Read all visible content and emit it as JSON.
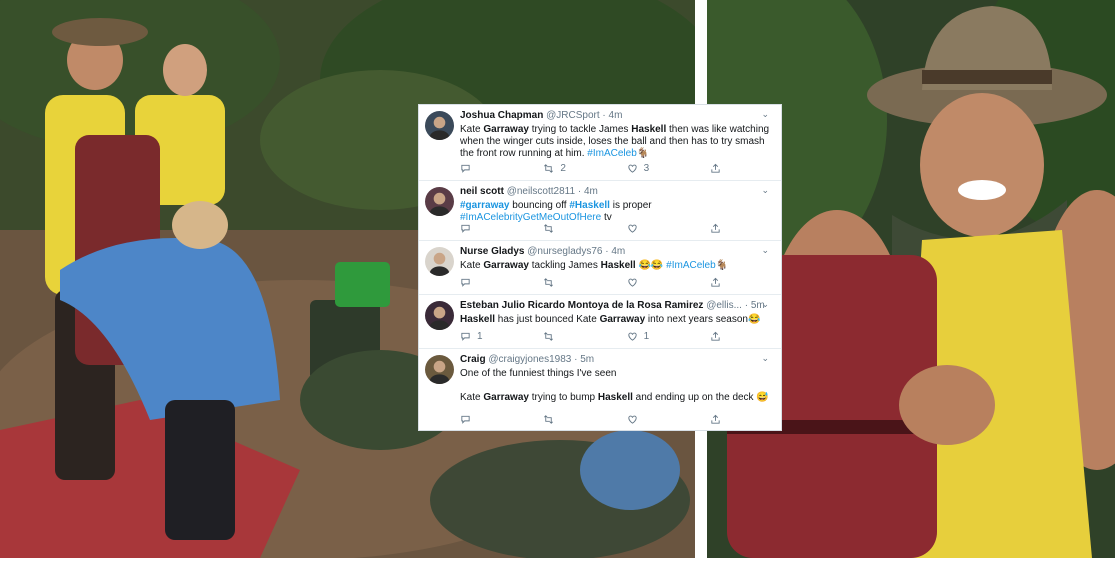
{
  "tweets": [
    {
      "name": "Joshua Chapman",
      "handle": "@JRCSport",
      "dot": "·",
      "time": "4m",
      "chevron": "⌄",
      "body": [
        [
          {
            "t": "Kate "
          },
          {
            "t": "Garraway",
            "b": true
          },
          {
            "t": " trying to tackle James "
          },
          {
            "t": "Haskell",
            "b": true
          },
          {
            "t": " then was like watching when the winger cuts inside, loses the ball and then has to try smash the front row running at him. "
          },
          {
            "t": "#ImACeleb",
            "link": true
          },
          {
            "t": "🐐"
          }
        ]
      ],
      "reply_count": "",
      "retweet_count": "2",
      "like_count": "3",
      "avatar_color": "#3b4a5a"
    },
    {
      "name": "neil scott",
      "handle": "@neilscott2811",
      "dot": "·",
      "time": "4m",
      "chevron": "⌄",
      "body": [
        [
          {
            "t": "#garraway",
            "link": true,
            "b": true
          },
          {
            "t": " bouncing off "
          },
          {
            "t": "#Haskell",
            "link": true,
            "b": true
          },
          {
            "t": " is proper "
          },
          {
            "t": "#ImACelebrityGetMeOutOfHere",
            "link": true
          },
          {
            "t": " tv"
          }
        ]
      ],
      "reply_count": "",
      "retweet_count": "",
      "like_count": "",
      "avatar_color": "#5a3c46"
    },
    {
      "name": "Nurse Gladys",
      "handle": "@nursegladys76",
      "dot": "·",
      "time": "4m",
      "chevron": "⌄",
      "body": [
        [
          {
            "t": "Kate "
          },
          {
            "t": "Garraway",
            "b": true
          },
          {
            "t": " tackling James "
          },
          {
            "t": "Haskell",
            "b": true
          },
          {
            "t": " 😂😂 "
          },
          {
            "t": "#ImACeleb",
            "link": true
          },
          {
            "t": "🐐"
          }
        ]
      ],
      "reply_count": "",
      "retweet_count": "",
      "like_count": "",
      "avatar_color": "#d9d4cc"
    },
    {
      "name": "Esteban Julio Ricardo Montoya de la Rosa Ramirez",
      "handle": "@ellis...",
      "dot": "·",
      "time": "5m",
      "chevron": "⌄",
      "body": [
        [
          {
            "t": "Haskell",
            "b": true
          },
          {
            "t": " has just bounced Kate "
          },
          {
            "t": "Garraway",
            "b": true
          },
          {
            "t": " into next years season😂"
          }
        ]
      ],
      "reply_count": "1",
      "retweet_count": "",
      "like_count": "1",
      "avatar_color": "#3a2a38"
    },
    {
      "name": "Craig",
      "handle": "@craigyjones1983",
      "dot": "·",
      "time": "5m",
      "chevron": "⌄",
      "body": [
        [
          {
            "t": "One of the funniest things I've seen"
          }
        ],
        [],
        [
          {
            "t": "Kate "
          },
          {
            "t": "Garraway",
            "b": true
          },
          {
            "t": " trying to bump "
          },
          {
            "t": "Haskell",
            "b": true
          },
          {
            "t": " and ending up on the deck 😅"
          }
        ]
      ],
      "reply_count": "",
      "retweet_count": "",
      "like_count": "",
      "avatar_color": "#6b5a3e"
    }
  ],
  "colors": {
    "link": "#1b95e0",
    "text": "#14171a",
    "muted": "#657786",
    "divider": "#e6ecf0"
  },
  "icons": [
    "reply-icon",
    "retweet-icon",
    "like-icon",
    "share-icon",
    "chevron-down-icon"
  ]
}
